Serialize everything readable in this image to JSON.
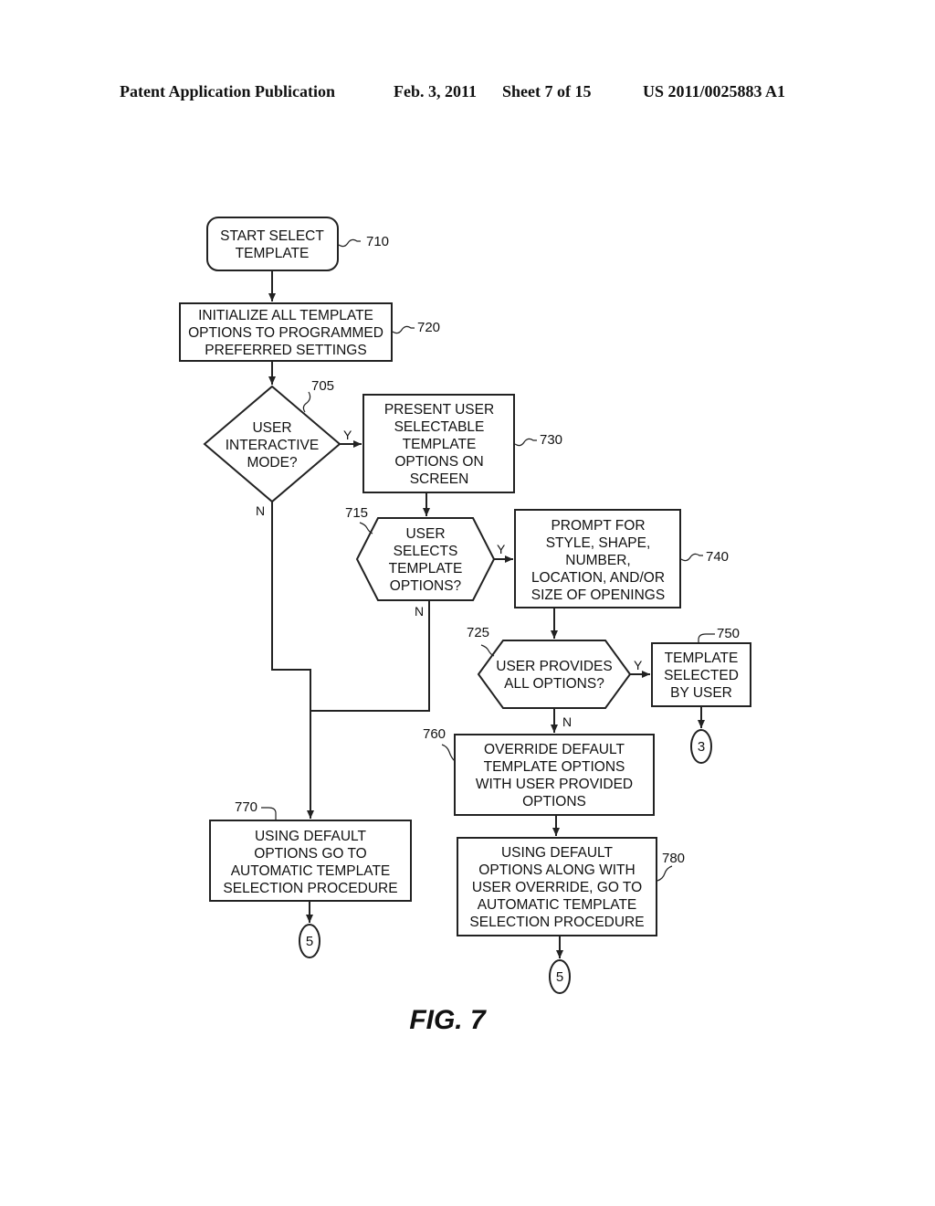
{
  "header": {
    "publication": "Patent Application Publication",
    "date": "Feb. 3, 2011",
    "sheet": "Sheet 7 of 15",
    "number": "US 2011/0025883 A1"
  },
  "nodes": {
    "n710": {
      "ref": "710",
      "lines": [
        "START SELECT",
        "TEMPLATE"
      ]
    },
    "n720": {
      "ref": "720",
      "lines": [
        "INITIALIZE ALL TEMPLATE",
        "OPTIONS TO PROGRAMMED",
        "PREFERRED SETTINGS"
      ]
    },
    "n705": {
      "ref": "705",
      "lines": [
        "USER",
        "INTERACTIVE",
        "MODE?"
      ]
    },
    "n730": {
      "ref": "730",
      "lines": [
        "PRESENT USER",
        "SELECTABLE",
        "TEMPLATE",
        "OPTIONS ON",
        "SCREEN"
      ]
    },
    "n715": {
      "ref": "715",
      "lines": [
        "USER",
        "SELECTS",
        "TEMPLATE",
        "OPTIONS?"
      ]
    },
    "n740": {
      "ref": "740",
      "lines": [
        "PROMPT FOR",
        "STYLE, SHAPE,",
        "NUMBER,",
        "LOCATION, AND/OR",
        "SIZE OF OPENINGS"
      ]
    },
    "n725": {
      "ref": "725",
      "lines": [
        "USER PROVIDES",
        "ALL OPTIONS?"
      ]
    },
    "n750": {
      "ref": "750",
      "lines": [
        "TEMPLATE",
        "SELECTED",
        "BY USER"
      ]
    },
    "n760": {
      "ref": "760",
      "lines": [
        "OVERRIDE DEFAULT",
        "TEMPLATE OPTIONS",
        "WITH USER PROVIDED",
        "OPTIONS"
      ]
    },
    "n770": {
      "ref": "770",
      "lines": [
        "USING DEFAULT",
        "OPTIONS GO TO",
        "AUTOMATIC TEMPLATE",
        "SELECTION PROCEDURE"
      ]
    },
    "n780": {
      "ref": "780",
      "lines": [
        "USING DEFAULT",
        "OPTIONS ALONG WITH",
        "USER OVERRIDE, GO TO",
        "AUTOMATIC TEMPLATE",
        "SELECTION PROCEDURE"
      ]
    }
  },
  "branches": {
    "yes": "Y",
    "no": "N"
  },
  "connectors": {
    "c750": "3",
    "c770": "5",
    "c780": "5"
  },
  "figure_label": "FIG. 7"
}
